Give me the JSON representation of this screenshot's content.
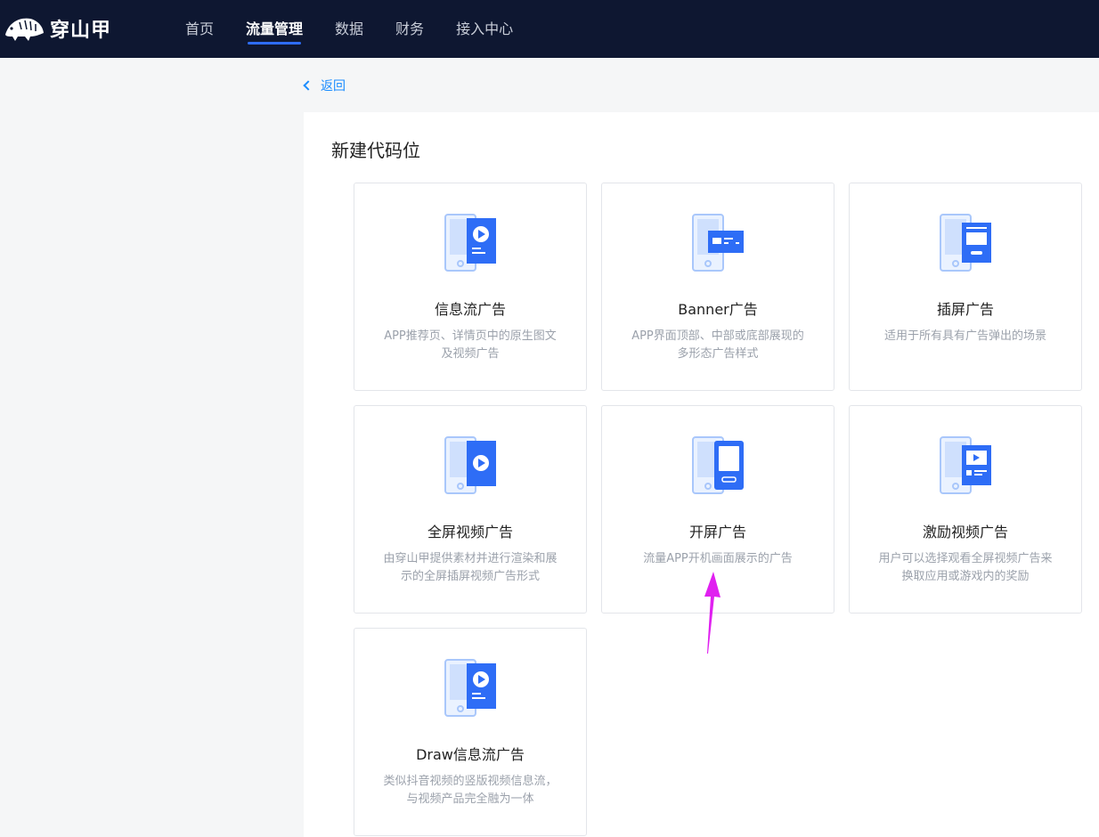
{
  "header": {
    "logo_text": "穿山甲",
    "nav": [
      {
        "label": "首页",
        "active": false
      },
      {
        "label": "流量管理",
        "active": true
      },
      {
        "label": "数据",
        "active": false
      },
      {
        "label": "财务",
        "active": false
      },
      {
        "label": "接入中心",
        "active": false
      }
    ]
  },
  "back_label": "返回",
  "panel_title": "新建代码位",
  "cards": [
    {
      "title": "信息流广告",
      "desc": "APP推荐页、详情页中的原生图文及视频广告",
      "icon": "feed-ad-icon"
    },
    {
      "title": "Banner广告",
      "desc": "APP界面顶部、中部或底部展现的多形态广告样式",
      "icon": "banner-ad-icon"
    },
    {
      "title": "插屏广告",
      "desc": "适用于所有具有广告弹出的场景",
      "icon": "interstitial-ad-icon"
    },
    {
      "title": "全屏视频广告",
      "desc": "由穿山甲提供素材并进行渲染和展示的全屏插屏视频广告形式",
      "icon": "fullscreen-video-ad-icon"
    },
    {
      "title": "开屏广告",
      "desc": "流量APP开机画面展示的广告",
      "icon": "splash-ad-icon"
    },
    {
      "title": "激励视频广告",
      "desc": "用户可以选择观看全屏视频广告来换取应用或游戏内的奖励",
      "icon": "rewarded-video-ad-icon"
    },
    {
      "title": "Draw信息流广告",
      "desc": "类似抖音视频的竖版视频信息流，与视频产品完全融为一体",
      "icon": "draw-feed-ad-icon"
    }
  ],
  "colors": {
    "header_bg": "#0e1731",
    "accent": "#2e6df6",
    "link": "#1a8cff",
    "annotation": "#e020f0"
  }
}
